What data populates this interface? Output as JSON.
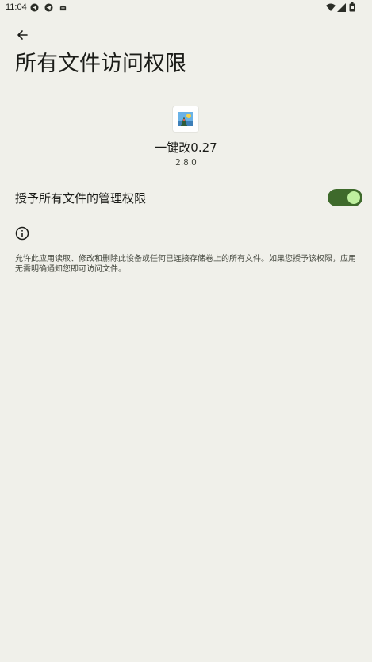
{
  "status_bar": {
    "time": "11:04",
    "left_icons": [
      "send-icon",
      "telegram-icon",
      "android-icon"
    ],
    "right_icons": [
      "wifi-icon",
      "signal-icon",
      "battery-icon"
    ]
  },
  "header": {
    "back_icon": "arrow-back-icon",
    "title": "所有文件访问权限"
  },
  "app": {
    "icon": "app-icon",
    "name": "一键改0.27",
    "version": "2.8.0"
  },
  "permission": {
    "label": "授予所有文件的管理权限",
    "enabled": true
  },
  "info": {
    "icon": "info-icon",
    "text": "允许此应用读取、修改和删除此设备或任何已连接存储卷上的所有文件。如果您授予该权限，应用无需明确通知您即可访问文件。"
  },
  "colors": {
    "background": "#f0f0ea",
    "toggle_track": "#3e6a2b",
    "toggle_thumb": "#bff09f"
  }
}
